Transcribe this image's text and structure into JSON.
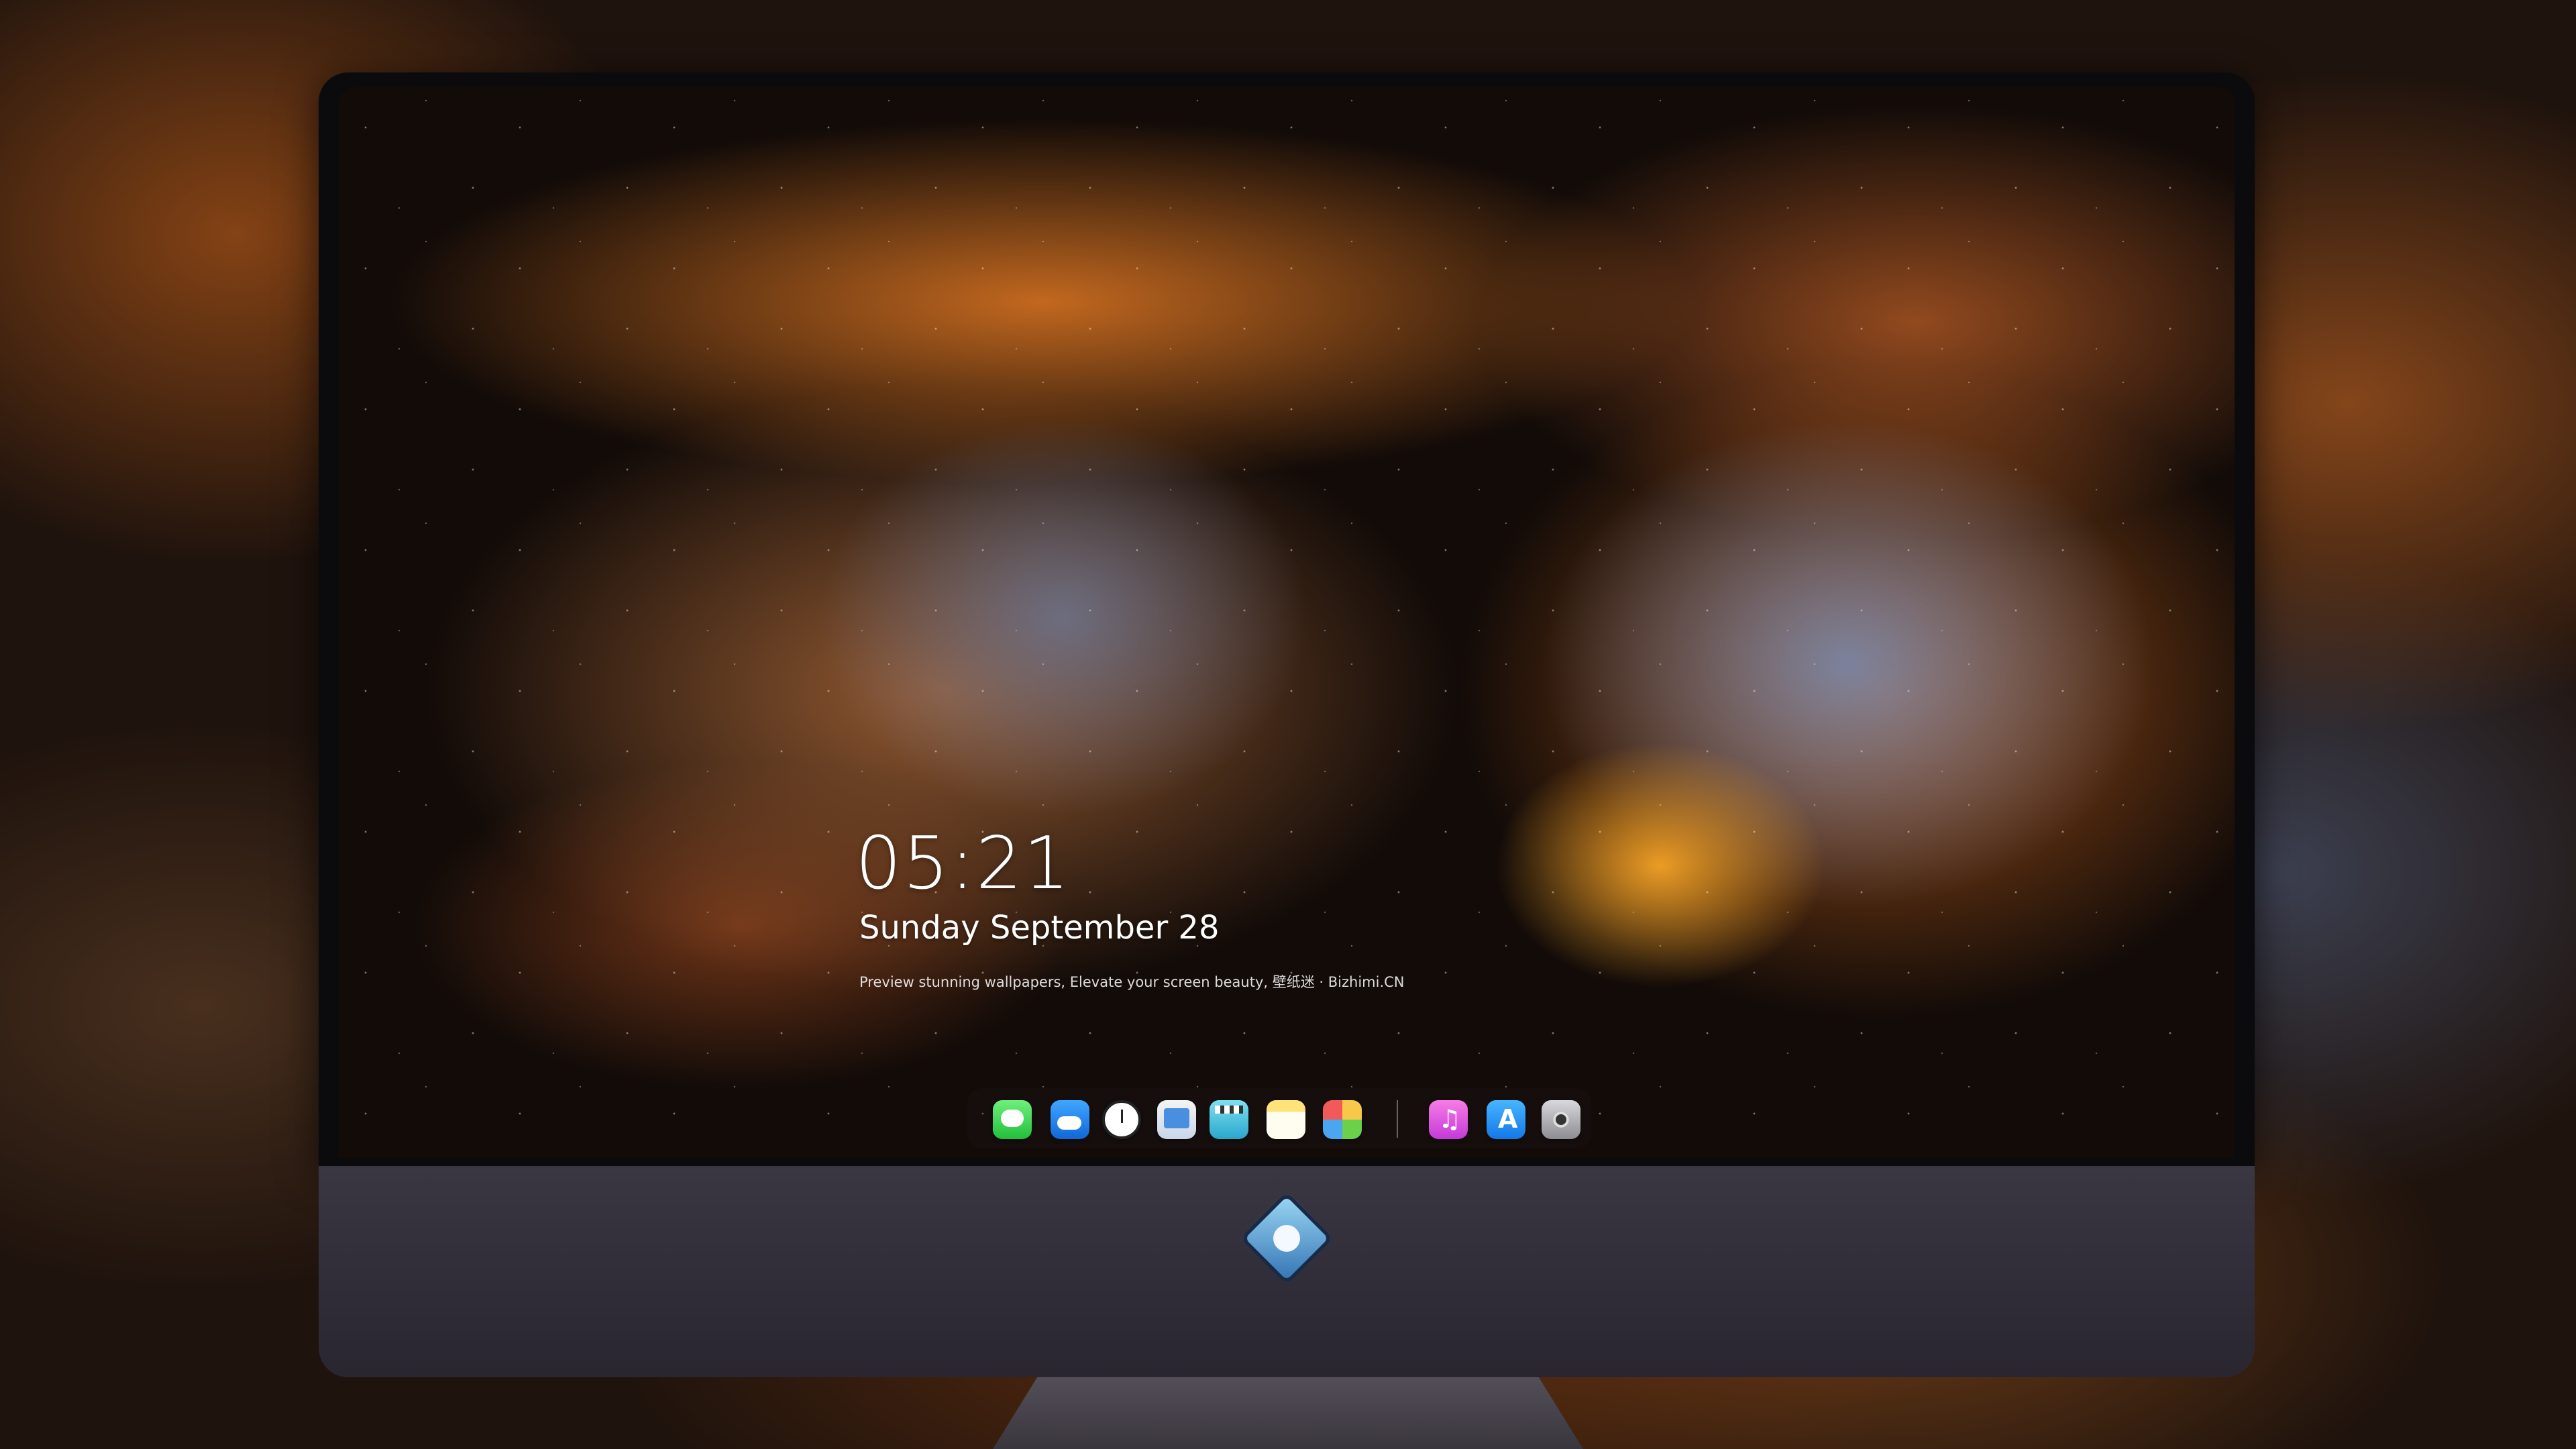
{
  "lock_screen": {
    "time": "05:21",
    "date": "Sunday September  28",
    "tagline": "Preview stunning wallpapers, Elevate your screen beauty, 壁纸迷 · Bizhimi.CN"
  },
  "dock": {
    "apps": [
      {
        "name": "Messages",
        "icon": "messages-icon"
      },
      {
        "name": "Weather",
        "icon": "weather-icon"
      },
      {
        "name": "Clock",
        "icon": "clock-icon"
      },
      {
        "name": "Preview",
        "icon": "preview-icon"
      },
      {
        "name": "Clips",
        "icon": "clips-icon"
      },
      {
        "name": "Notes",
        "icon": "notes-icon"
      },
      {
        "name": "Photos",
        "icon": "photos-icon"
      },
      {
        "name": "Music",
        "icon": "music-icon"
      },
      {
        "name": "App Store",
        "icon": "app-store-icon"
      },
      {
        "name": "Camera",
        "icon": "camera-icon"
      }
    ]
  },
  "monitor": {
    "chin_logo": "brand-logo-icon"
  },
  "colors": {
    "nebula_orange": "#d9782a",
    "nebula_blue": "#7c8cb4",
    "chin": "#34303a",
    "bezel": "#0b0b0d"
  }
}
